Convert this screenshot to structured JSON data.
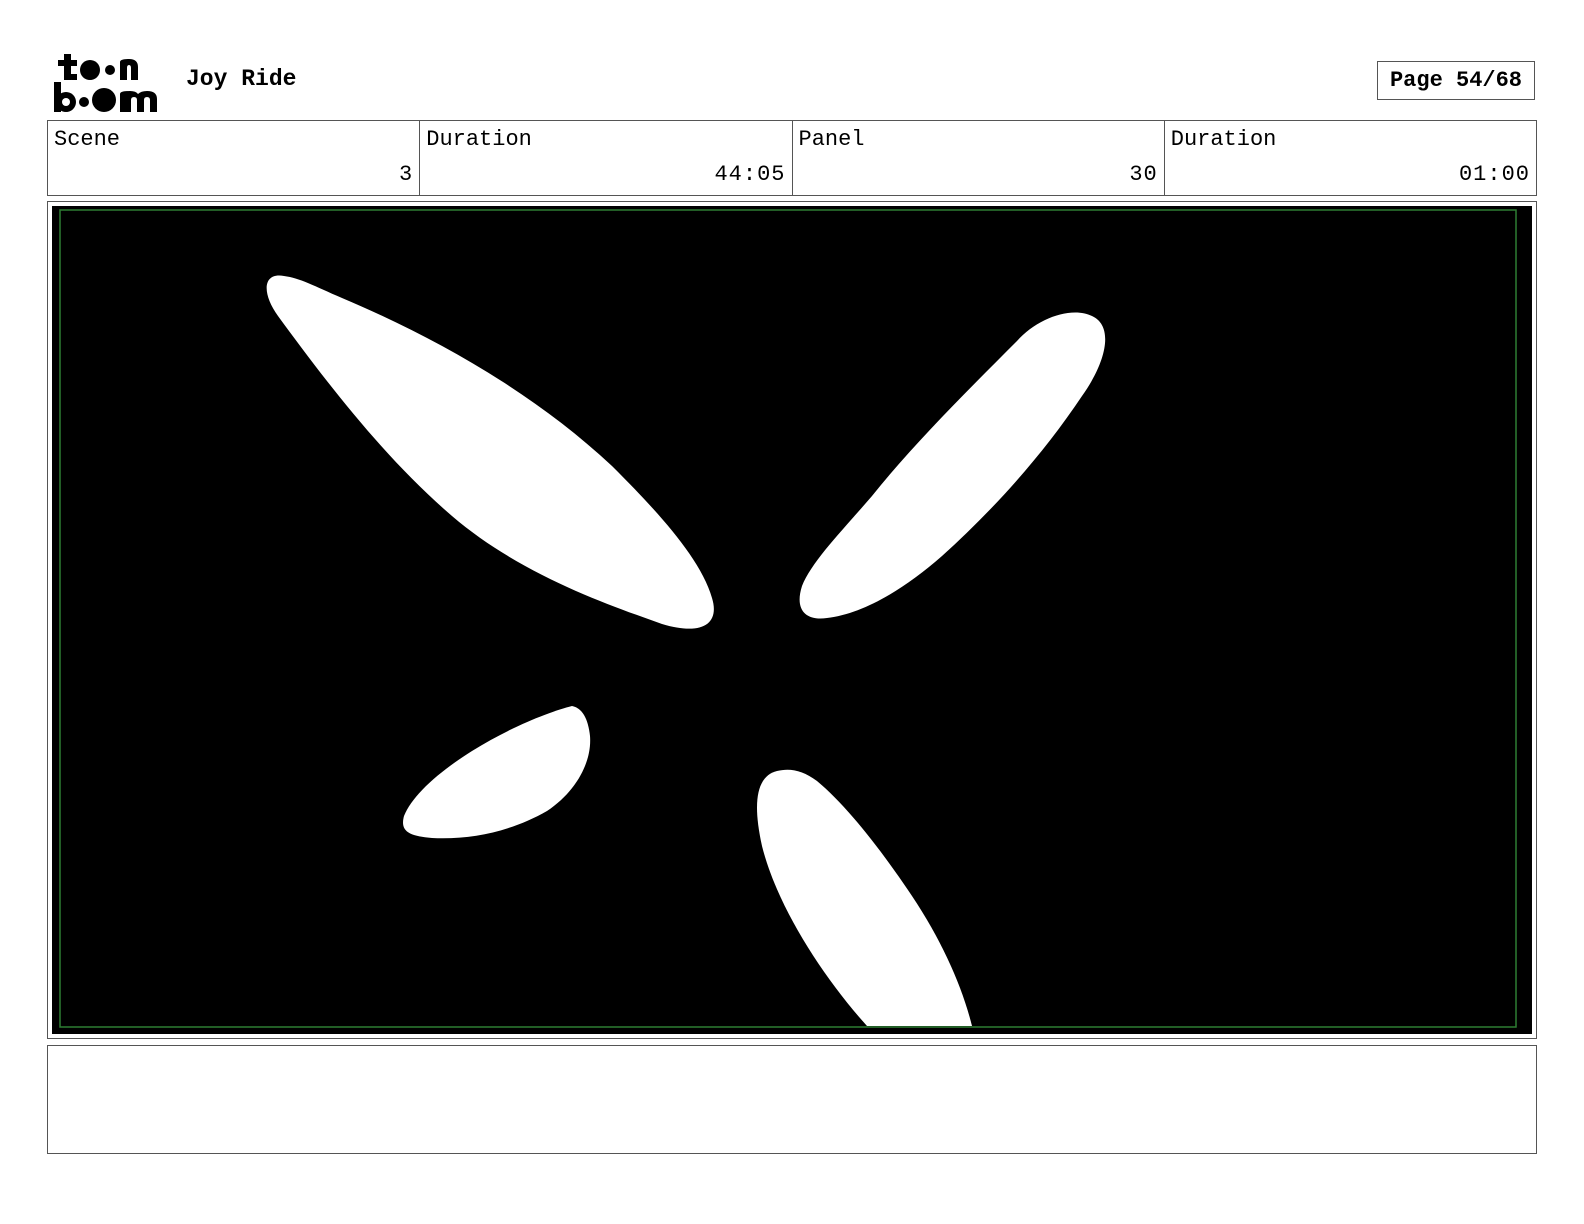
{
  "header": {
    "project_title": "Joy Ride",
    "page_label": "Page 54/68"
  },
  "info": {
    "scene_label": "Scene",
    "scene_value": "3",
    "scene_duration_label": "Duration",
    "scene_duration_value": "44:05",
    "panel_label": "Panel",
    "panel_value": "30",
    "panel_duration_label": "Duration",
    "panel_duration_value": "01:00"
  },
  "notes": {
    "text": ""
  },
  "colors": {
    "frame_background": "#000000",
    "shapes": "#ffffff",
    "safe_area_border": "#2e7d32"
  },
  "logo_icon": "toonboom-logo-icon"
}
